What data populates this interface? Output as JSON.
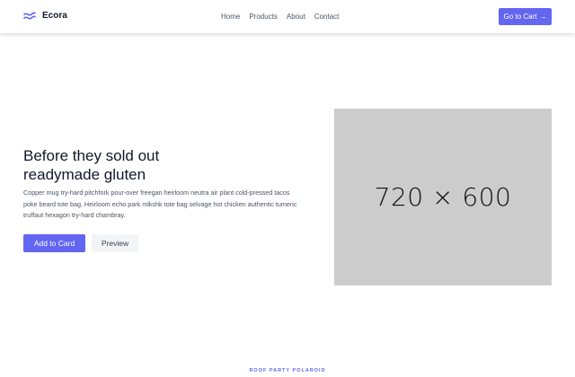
{
  "navbar": {
    "brand": "Ecora",
    "logo_icon": "logo-icon",
    "links": [
      "Home",
      "Products",
      "About",
      "Contact"
    ],
    "cart_button": "Go to Cart",
    "cart_icon": "arrow-right-icon"
  },
  "hero": {
    "title_line1": "Before they sold out",
    "title_line2": "readymade gluten",
    "description": "Copper mug try-hard pitchfork pour-over freegan heirloom neutra air plant cold-pressed tacos poke beard tote bag. Heirloom echo park mlkshk tote bag selvage hot chicken authentic tumeric truffaut hexagon try-hard chambray.",
    "primary_button": "Add to Card",
    "secondary_button": "Preview",
    "image_placeholder": "720 × 600"
  },
  "next_section": {
    "eyebrow": "ROOF PARTY POLAROID"
  },
  "colors": {
    "accent": "#6366f1",
    "placeholder_bg": "#cccccc",
    "secondary_bg": "#f3f4f6"
  }
}
